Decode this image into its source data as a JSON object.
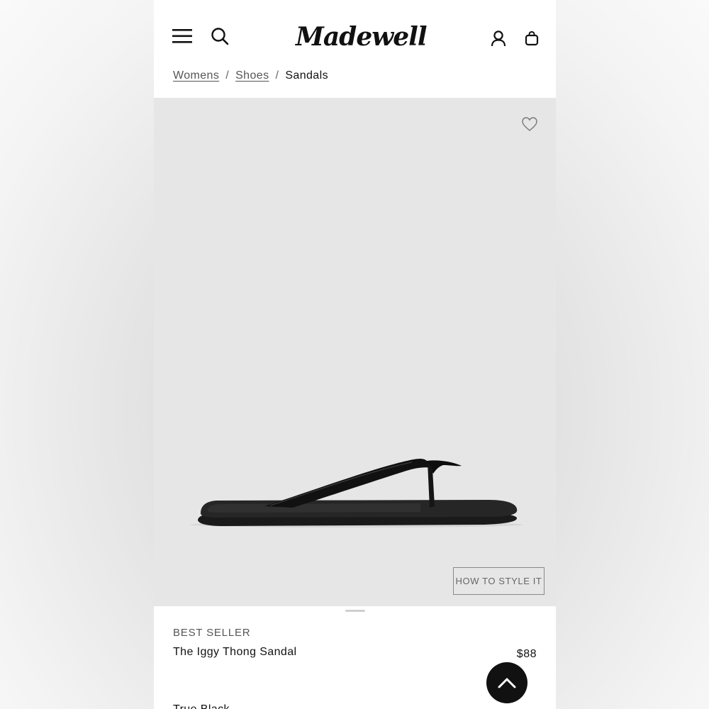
{
  "header": {
    "logo_text": "Madewell",
    "icons": [
      "menu-icon",
      "search-icon",
      "account-icon",
      "bag-icon"
    ]
  },
  "breadcrumb": {
    "items": [
      {
        "label": "Womens"
      },
      {
        "label": "Shoes"
      }
    ],
    "separator": "/",
    "current": "Sandals"
  },
  "hero": {
    "background": "#e6e6e6",
    "wishlist_icon": "heart-icon",
    "style_button_label": "HOW TO STYLE IT"
  },
  "product": {
    "badge": "BEST SELLER",
    "name": "The Iggy Thong Sandal",
    "price": "$88",
    "color_partial": "True Black"
  },
  "scroll_top": {
    "icon": "chevron-up-icon",
    "background": "#111111"
  }
}
